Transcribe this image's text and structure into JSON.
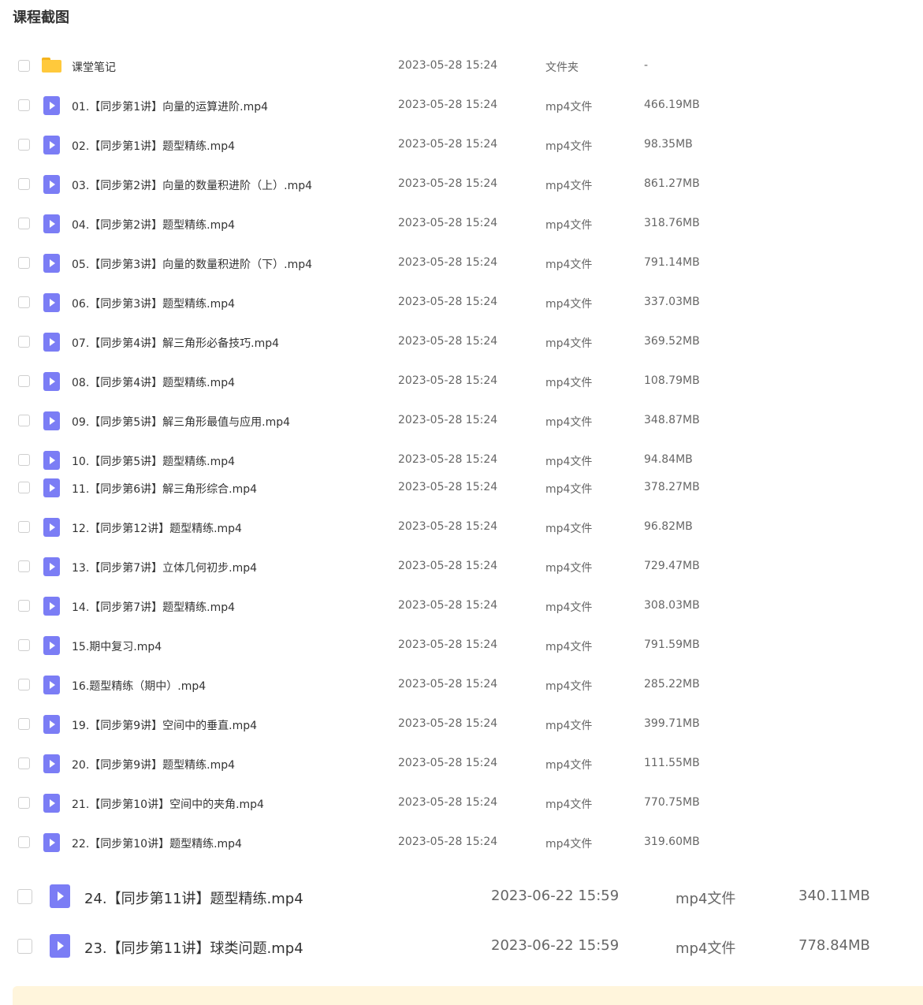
{
  "header": {
    "title": "课程截图"
  },
  "folder": {
    "name": "课堂笔记",
    "date": "2023-05-28 15:24",
    "type": "文件夹",
    "size": "-"
  },
  "files": [
    {
      "name": "01.【同步第1讲】向量的运算进阶.mp4",
      "date": "2023-05-28 15:24",
      "type": "mp4文件",
      "size": "466.19MB"
    },
    {
      "name": "02.【同步第1讲】题型精练.mp4",
      "date": "2023-05-28 15:24",
      "type": "mp4文件",
      "size": "98.35MB"
    },
    {
      "name": "03.【同步第2讲】向量的数量积进阶（上）.mp4",
      "date": "2023-05-28 15:24",
      "type": "mp4文件",
      "size": "861.27MB"
    },
    {
      "name": "04.【同步第2讲】题型精练.mp4",
      "date": "2023-05-28 15:24",
      "type": "mp4文件",
      "size": "318.76MB"
    },
    {
      "name": "05.【同步第3讲】向量的数量积进阶（下）.mp4",
      "date": "2023-05-28 15:24",
      "type": "mp4文件",
      "size": "791.14MB"
    },
    {
      "name": "06.【同步第3讲】题型精练.mp4",
      "date": "2023-05-28 15:24",
      "type": "mp4文件",
      "size": "337.03MB"
    },
    {
      "name": "07.【同步第4讲】解三角形必备技巧.mp4",
      "date": "2023-05-28 15:24",
      "type": "mp4文件",
      "size": "369.52MB"
    },
    {
      "name": "08.【同步第4讲】题型精练.mp4",
      "date": "2023-05-28 15:24",
      "type": "mp4文件",
      "size": "108.79MB"
    },
    {
      "name": "09.【同步第5讲】解三角形最值与应用.mp4",
      "date": "2023-05-28 15:24",
      "type": "mp4文件",
      "size": "348.87MB"
    },
    {
      "name": "10.【同步第5讲】题型精练.mp4",
      "date": "2023-05-28 15:24",
      "type": "mp4文件",
      "size": "94.84MB"
    },
    {
      "name": "11.【同步第6讲】解三角形综合.mp4",
      "date": "2023-05-28 15:24",
      "type": "mp4文件",
      "size": "378.27MB"
    },
    {
      "name": "12.【同步第12讲】题型精练.mp4",
      "date": "2023-05-28 15:24",
      "type": "mp4文件",
      "size": "96.82MB"
    },
    {
      "name": "13.【同步第7讲】立体几何初步.mp4",
      "date": "2023-05-28 15:24",
      "type": "mp4文件",
      "size": "729.47MB"
    },
    {
      "name": "14.【同步第7讲】题型精练.mp4",
      "date": "2023-05-28 15:24",
      "type": "mp4文件",
      "size": "308.03MB"
    },
    {
      "name": "15.期中复习.mp4",
      "date": "2023-05-28 15:24",
      "type": "mp4文件",
      "size": "791.59MB"
    },
    {
      "name": "16.题型精练（期中）.mp4",
      "date": "2023-05-28 15:24",
      "type": "mp4文件",
      "size": "285.22MB"
    },
    {
      "name": "19.【同步第9讲】空间中的垂直.mp4",
      "date": "2023-05-28 15:24",
      "type": "mp4文件",
      "size": "399.71MB"
    },
    {
      "name": "20.【同步第9讲】题型精练.mp4",
      "date": "2023-05-28 15:24",
      "type": "mp4文件",
      "size": "111.55MB"
    },
    {
      "name": "21.【同步第10讲】空间中的夹角.mp4",
      "date": "2023-05-28 15:24",
      "type": "mp4文件",
      "size": "770.75MB"
    },
    {
      "name": "22.【同步第10讲】题型精练.mp4",
      "date": "2023-05-28 15:24",
      "type": "mp4文件",
      "size": "319.60MB"
    }
  ],
  "recent_files": [
    {
      "name": "24.【同步第11讲】题型精练.mp4",
      "date": "2023-06-22 15:59",
      "type": "mp4文件",
      "size": "340.11MB"
    },
    {
      "name": "23.【同步第11讲】球类问题.mp4",
      "date": "2023-06-22 15:59",
      "type": "mp4文件",
      "size": "778.84MB"
    }
  ],
  "colors": {
    "folder": "#ffc93c",
    "video_icon": "#7b7df5",
    "notice_bar": "#fff5dc"
  }
}
